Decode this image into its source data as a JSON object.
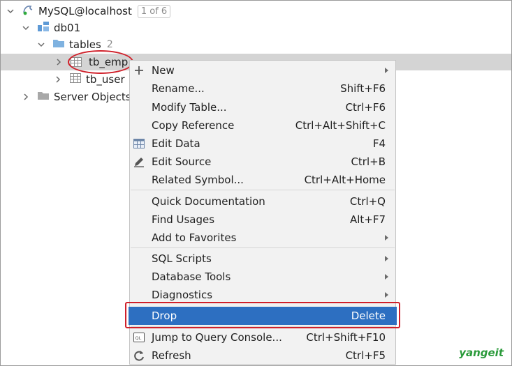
{
  "tree": {
    "root": {
      "label": "MySQL@localhost",
      "pager": "1 of 6"
    },
    "db": {
      "label": "db01"
    },
    "tables": {
      "label": "tables",
      "count": "2"
    },
    "items": [
      {
        "label": "tb_emp"
      },
      {
        "label": "tb_user"
      }
    ],
    "server_objects": {
      "label": "Server Objects"
    }
  },
  "menu": {
    "items": [
      {
        "label": "New",
        "shortcut": "",
        "submenu": true,
        "icon": "plus-icon"
      },
      {
        "label": "Rename...",
        "shortcut": "Shift+F6"
      },
      {
        "label": "Modify Table...",
        "shortcut": "Ctrl+F6"
      },
      {
        "label": "Copy Reference",
        "shortcut": "Ctrl+Alt+Shift+C"
      },
      {
        "label": "Edit Data",
        "shortcut": "F4",
        "icon": "table-grid-icon"
      },
      {
        "label": "Edit Source",
        "shortcut": "Ctrl+B",
        "icon": "pencil-icon"
      },
      {
        "label": "Related Symbol...",
        "shortcut": "Ctrl+Alt+Home"
      },
      {
        "label": "Quick Documentation",
        "shortcut": "Ctrl+Q"
      },
      {
        "label": "Find Usages",
        "shortcut": "Alt+F7"
      },
      {
        "label": "Add to Favorites",
        "shortcut": "",
        "submenu": true
      },
      {
        "label": "SQL Scripts",
        "shortcut": "",
        "submenu": true
      },
      {
        "label": "Database Tools",
        "shortcut": "",
        "submenu": true
      },
      {
        "label": "Diagnostics",
        "shortcut": "",
        "submenu": true
      },
      {
        "label": "Drop",
        "shortcut": "Delete",
        "active": true
      },
      {
        "label": "Jump to Query Console...",
        "shortcut": "Ctrl+Shift+F10",
        "icon": "query-console-icon"
      },
      {
        "label": "Refresh",
        "shortcut": "Ctrl+F5",
        "icon": "refresh-icon"
      }
    ]
  },
  "watermark": "yangeit",
  "colors": {
    "accent": "#2d6fc1",
    "highlight_ring": "#d0202a",
    "selection": "#d4d4d4"
  }
}
